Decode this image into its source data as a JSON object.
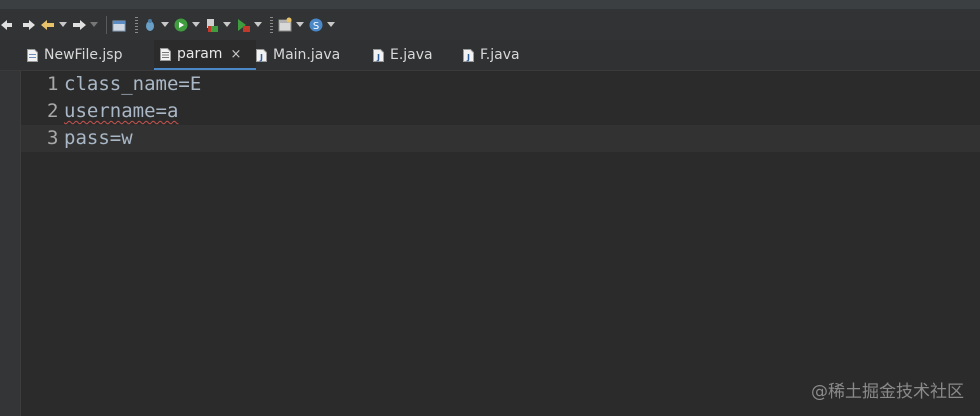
{
  "editor_tabs": [
    {
      "label": "NewFile.jsp",
      "icon": "jsp-file-icon",
      "active": false
    },
    {
      "label": "param",
      "icon": "text-file-icon",
      "active": true,
      "close": "×"
    },
    {
      "label": "Main.java",
      "icon": "java-file-icon",
      "active": false
    },
    {
      "label": "E.java",
      "icon": "java-file-icon",
      "active": false
    },
    {
      "label": "F.java",
      "icon": "java-file-icon",
      "active": false
    }
  ],
  "lines": [
    {
      "number": "1",
      "text": "class_name=E"
    },
    {
      "number": "2",
      "text": "username=a"
    },
    {
      "number": "3",
      "text": "pass=w"
    }
  ],
  "watermark": "@稀土掘金技术社区",
  "colors": {
    "background": "#2b2b2b",
    "code_text": "#a9b7c6",
    "active_tab_underline": "#4a88c7"
  }
}
